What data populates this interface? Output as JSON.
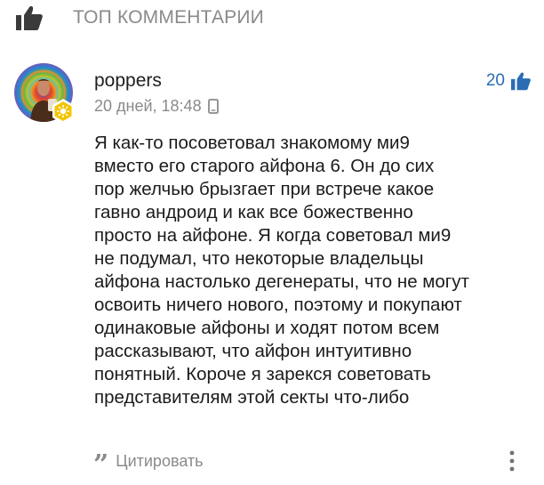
{
  "header": {
    "icon": "thumbs-up-icon",
    "title": "ТОП КОММЕНТАРИИ"
  },
  "comment": {
    "username": "poppers",
    "time": "20 дней, 18:48",
    "device_icon": "phone-icon",
    "likes": "20",
    "likes_icon": "thumbs-up-icon",
    "text": "Я как-то посоветовал знакомому ми9\nвместо его старого айфона 6. Он до сих\nпор желчью брызгает при встрече какое\nгавно андроид и как все божественно\nпросто на айфоне. Я когда советовал ми9\nне подумал, что некоторые владельцы\nайфона настолько дегенераты, что не могут\nосвоить ничего нового, поэтому и покупают\nодинаковые айфоны и ходят потом всем\nрассказывают, что айфон интуитивно\nпонятный. Короче я зарекся советовать\nпредставителям этой секты что-либо"
  },
  "actions": {
    "quote_icon": "quote-icon",
    "quote_label": "Цитировать",
    "more_icon": "more-vertical-icon"
  },
  "colors": {
    "accent": "#2a6db5",
    "muted": "#8a8a8a",
    "text": "#1b1b1b",
    "badge": "#f5c400"
  }
}
